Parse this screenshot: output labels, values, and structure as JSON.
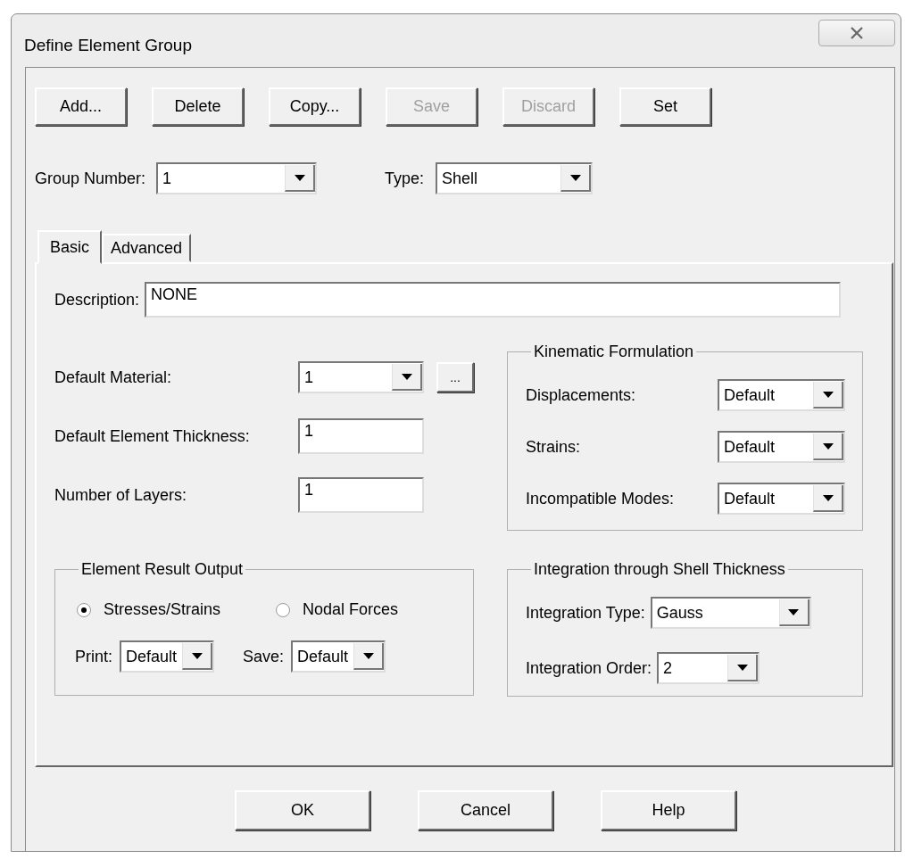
{
  "window": {
    "title": "Define Element Group"
  },
  "toolbar": [
    {
      "label": "Add...",
      "disabled": false
    },
    {
      "label": "Delete",
      "disabled": false
    },
    {
      "label": "Copy...",
      "disabled": false
    },
    {
      "label": "Save",
      "disabled": true
    },
    {
      "label": "Discard",
      "disabled": true
    },
    {
      "label": "Set",
      "disabled": false
    }
  ],
  "group_number": {
    "label": "Group Number:",
    "value": "1"
  },
  "type": {
    "label": "Type:",
    "value": "Shell"
  },
  "tabs": [
    {
      "label": "Basic",
      "selected": true
    },
    {
      "label": "Advanced",
      "selected": false
    }
  ],
  "description": {
    "label": "Description:",
    "value": "NONE"
  },
  "default_material": {
    "label": "Default Material:",
    "value": "1",
    "browse": "..."
  },
  "thickness": {
    "label": "Default Element Thickness:",
    "value": "1"
  },
  "layers": {
    "label": "Number of Layers:",
    "value": "1"
  },
  "kinematic": {
    "title": "Kinematic Formulation",
    "rows": [
      {
        "label": "Displacements:",
        "value": "Default"
      },
      {
        "label": "Strains:",
        "value": "Default"
      },
      {
        "label": "Incompatible Modes:",
        "value": "Default"
      }
    ]
  },
  "result_output": {
    "title": "Element Result Output",
    "options": [
      {
        "label": "Stresses/Strains",
        "selected": true
      },
      {
        "label": "Nodal Forces",
        "selected": false
      }
    ],
    "print": {
      "label": "Print:",
      "value": "Default"
    },
    "save": {
      "label": "Save:",
      "value": "Default"
    }
  },
  "integration": {
    "title": "Integration through Shell Thickness",
    "rows": [
      {
        "label": "Integration Type:",
        "value": "Gauss"
      },
      {
        "label": "Integration Order:",
        "value": "2"
      }
    ]
  },
  "buttons": [
    "OK",
    "Cancel",
    "Help"
  ]
}
